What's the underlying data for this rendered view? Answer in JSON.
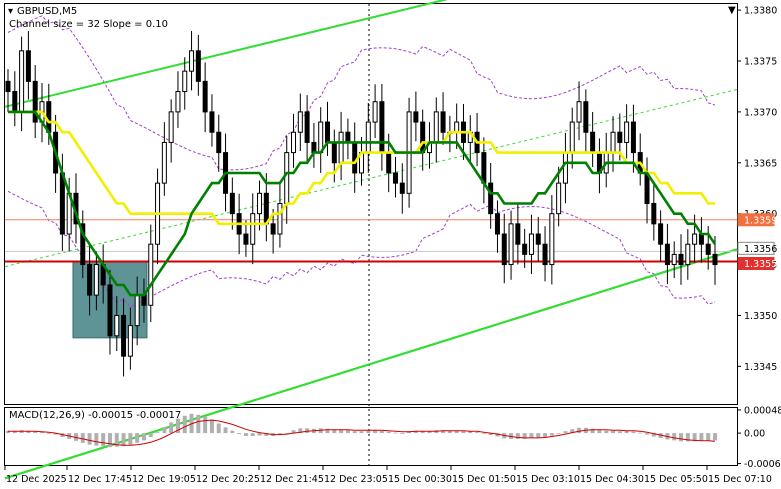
{
  "header": {
    "symbol": "GBPUSD,M5",
    "channel_info": "Channel size = 32 Slope = 0.10"
  },
  "macd_header": "MACD(12,26,9) -0.00015 -0.00017",
  "colors": {
    "background": "#ffffff",
    "candles": "#000000",
    "ma_fast": "#008000",
    "ma_slow": "#f0f000",
    "bollinger": "#a040d0",
    "channel": "#33dd33",
    "channel_mid": "#33dd33",
    "support": "#d00000",
    "level_orange": "#f08060",
    "zone": "#5f9497",
    "macd_hist": "#b0b0b0",
    "macd_signal": "#d00000",
    "price_tag_red": "#e03030",
    "price_tag_orange": "#f07040",
    "grid": "#d8d8d8"
  },
  "chart_data": {
    "type": "candlestick",
    "title": "GBPUSD,M5",
    "subtitle": "Channel size = 32 Slope = 0.10",
    "y_ticks": [
      "1.3380",
      "1.3375",
      "1.3370",
      "1.3365",
      "1.3360",
      "1.3355",
      "1.3350",
      "1.3345"
    ],
    "y_tick_values": [
      1.338,
      1.3375,
      1.337,
      1.3365,
      1.336,
      1.3355,
      1.335,
      1.3345
    ],
    "ylim": [
      1.33413,
      1.33806
    ],
    "x_ticks": [
      "12 Dec 2025",
      "12 Dec 17:45",
      "12 Dec 19:05",
      "12 Dec 20:25",
      "12 Dec 21:45",
      "12 Dec 23:05",
      "15 Dec 00:30",
      "15 Dec 01:50",
      "15 Dec 03:10",
      "15 Dec 04:30",
      "15 Dec 05:50",
      "15 Dec 07:10"
    ],
    "price_tags": [
      {
        "text": "1.3359",
        "value": 1.33594,
        "kind": "orange"
      },
      {
        "text": "1.3356",
        "value": 1.33563,
        "kind": "gray"
      },
      {
        "text": "1.3355",
        "value": 1.33553,
        "kind": "red"
      }
    ],
    "horizontal_levels": [
      {
        "value": 1.33594,
        "kind": "orange"
      },
      {
        "value": 1.33553,
        "kind": "support"
      }
    ],
    "close": [
      1.3372,
      1.337,
      1.3376,
      1.3373,
      1.3369,
      1.3371,
      1.3368,
      1.3364,
      1.3358,
      1.3362,
      1.3359,
      1.3355,
      1.3352,
      1.3355,
      1.3353,
      1.3348,
      1.335,
      1.3346,
      1.3349,
      1.3352,
      1.3351,
      1.3357,
      1.3363,
      1.3367,
      1.337,
      1.3372,
      1.3374,
      1.3376,
      1.3373,
      1.337,
      1.3368,
      1.3366,
      1.3362,
      1.336,
      1.3358,
      1.3357,
      1.336,
      1.3362,
      1.3359,
      1.3358,
      1.3361,
      1.3366,
      1.3368,
      1.337,
      1.3367,
      1.3366,
      1.3369,
      1.3367,
      1.3365,
      1.3368,
      1.3367,
      1.3364,
      1.3366,
      1.3369,
      1.3371,
      1.3366,
      1.3364,
      1.3363,
      1.3362,
      1.337,
      1.3369,
      1.3366,
      1.3367,
      1.337,
      1.3368,
      1.3368,
      1.3369,
      1.3367,
      1.3368,
      1.3366,
      1.3363,
      1.336,
      1.3358,
      1.3355,
      1.3359,
      1.3357,
      1.3356,
      1.3358,
      1.3357,
      1.3355,
      1.336,
      1.3363,
      1.3366,
      1.3369,
      1.3371,
      1.3368,
      1.3366,
      1.3364,
      1.3366,
      1.3368,
      1.3367,
      1.3369,
      1.3366,
      1.3364,
      1.3361,
      1.3359,
      1.3357,
      1.3355,
      1.3356,
      1.3355,
      1.3357,
      1.3358,
      1.3357,
      1.3356,
      1.3355
    ],
    "ma_fast": [
      1.337,
      1.337,
      1.337,
      1.337,
      1.337,
      1.3369,
      1.3368,
      1.3366,
      1.3364,
      1.3362,
      1.336,
      1.3358,
      1.3357,
      1.3356,
      1.3355,
      1.3354,
      1.3353,
      1.3353,
      1.3352,
      1.3352,
      1.3352,
      1.3353,
      1.3354,
      1.3355,
      1.3356,
      1.3357,
      1.3358,
      1.336,
      1.3361,
      1.3362,
      1.3363,
      1.3363,
      1.3364,
      1.3364,
      1.3364,
      1.3364,
      1.3364,
      1.3364,
      1.3363,
      1.3363,
      1.3363,
      1.3364,
      1.3364,
      1.3365,
      1.3365,
      1.3366,
      1.3366,
      1.3367,
      1.3367,
      1.3367,
      1.3367,
      1.3367,
      1.3367,
      1.3367,
      1.3367,
      1.3367,
      1.3367,
      1.3366,
      1.3366,
      1.3366,
      1.3366,
      1.3366,
      1.3367,
      1.3367,
      1.3367,
      1.3367,
      1.3367,
      1.3366,
      1.3365,
      1.3364,
      1.3363,
      1.3362,
      1.3362,
      1.3361,
      1.3361,
      1.3361,
      1.3361,
      1.3361,
      1.3362,
      1.3362,
      1.3363,
      1.3364,
      1.3365,
      1.3365,
      1.3365,
      1.3365,
      1.3364,
      1.3364,
      1.3365,
      1.3365,
      1.3365,
      1.3365,
      1.3365,
      1.3364,
      1.3364,
      1.3363,
      1.3362,
      1.3361,
      1.336,
      1.336,
      1.3359,
      1.3359,
      1.3358,
      1.3358,
      1.3357
    ],
    "ma_slow": [
      1.337,
      1.337,
      1.337,
      1.337,
      1.337,
      1.337,
      1.3369,
      1.3369,
      1.3368,
      1.3368,
      1.3367,
      1.3366,
      1.3365,
      1.3364,
      1.3363,
      1.3362,
      1.3361,
      1.3361,
      1.336,
      1.336,
      1.336,
      1.336,
      1.336,
      1.336,
      1.336,
      1.336,
      1.336,
      1.336,
      1.336,
      1.336,
      1.336,
      1.3359,
      1.3359,
      1.3359,
      1.3359,
      1.3359,
      1.3359,
      1.3359,
      1.3359,
      1.336,
      1.336,
      1.3361,
      1.3361,
      1.3362,
      1.3362,
      1.3363,
      1.3363,
      1.3364,
      1.3364,
      1.3365,
      1.3365,
      1.3365,
      1.3366,
      1.3366,
      1.3366,
      1.3366,
      1.3366,
      1.3366,
      1.3366,
      1.3366,
      1.3366,
      1.3367,
      1.3367,
      1.3367,
      1.3367,
      1.3368,
      1.3368,
      1.3368,
      1.3368,
      1.3367,
      1.3367,
      1.3367,
      1.3366,
      1.3366,
      1.3366,
      1.3366,
      1.3366,
      1.3366,
      1.3366,
      1.3366,
      1.3366,
      1.3366,
      1.3366,
      1.3366,
      1.3366,
      1.3366,
      1.3366,
      1.3366,
      1.3366,
      1.3366,
      1.3366,
      1.3365,
      1.3365,
      1.3365,
      1.3364,
      1.3364,
      1.3363,
      1.3363,
      1.3362,
      1.3362,
      1.3362,
      1.3362,
      1.3362,
      1.3361,
      1.3361
    ],
    "macd": {
      "label": "MACD(12,26,9)",
      "main": -0.00015,
      "signal": -0.00017,
      "y_ticks": [
        "0.00048",
        "0.00",
        "-0.00063"
      ],
      "y_tick_values": [
        0.00048,
        0.0,
        -0.00063
      ],
      "ylim": [
        -0.00066,
        0.00052
      ],
      "histogram": [
        5e-05,
        4e-05,
        6e-05,
        5e-05,
        4e-05,
        2e-05,
        0.0,
        -3e-05,
        -8e-05,
        -0.00012,
        -0.00016,
        -0.0002,
        -0.00024,
        -0.00026,
        -0.00027,
        -0.00029,
        -0.00028,
        -0.00027,
        -0.00024,
        -0.0002,
        -0.00015,
        -8e-05,
        2e-05,
        0.00012,
        0.00022,
        0.0003,
        0.00036,
        0.0004,
        0.00038,
        0.00034,
        0.00028,
        0.0002,
        0.00012,
        5e-05,
        -2e-05,
        -6e-05,
        -6e-05,
        -5e-05,
        -6e-05,
        -6e-05,
        -4e-05,
        0.0,
        6e-05,
        0.0001,
        0.0001,
        9e-05,
        0.0001,
        9e-05,
        7e-05,
        7e-05,
        6e-05,
        4e-05,
        4e-05,
        5e-05,
        7e-05,
        5e-05,
        3e-05,
        1e-05,
        0.0,
        4e-05,
        5e-05,
        4e-05,
        4e-05,
        6e-05,
        6e-05,
        5e-05,
        5e-05,
        4e-05,
        4e-05,
        2e-05,
        -1e-05,
        -4e-05,
        -7e-05,
        -0.00011,
        -0.00012,
        -0.00012,
        -0.00012,
        -0.0001,
        -9e-05,
        -9e-05,
        -5e-05,
        0.0,
        4e-05,
        8e-05,
        0.00011,
        0.00011,
        9e-05,
        6e-05,
        5e-05,
        5e-05,
        4e-05,
        5e-05,
        3e-05,
        1e-05,
        -3e-05,
        -7e-05,
        -0.0001,
        -0.00013,
        -0.00015,
        -0.00017,
        -0.00017,
        -0.00017,
        -0.00016,
        -0.00016,
        -0.00015
      ],
      "signal_line": [
        4e-05,
        4e-05,
        4e-05,
        4e-05,
        4e-05,
        3e-05,
        2e-05,
        0.0,
        -3e-05,
        -6e-05,
        -9e-05,
        -0.00012,
        -0.00015,
        -0.00018,
        -0.0002,
        -0.00022,
        -0.00024,
        -0.00025,
        -0.00025,
        -0.00024,
        -0.00022,
        -0.00019,
        -0.00014,
        -8e-05,
        -1e-05,
        6e-05,
        0.00013,
        0.00019,
        0.00024,
        0.00026,
        0.00027,
        0.00025,
        0.00022,
        0.00018,
        0.00013,
        8e-05,
        4e-05,
        1e-05,
        -1e-05,
        -3e-05,
        -3e-05,
        -2e-05,
        0.0,
        2e-05,
        4e-05,
        5e-05,
        6e-05,
        7e-05,
        7e-05,
        7e-05,
        7e-05,
        6e-05,
        6e-05,
        6e-05,
        6e-05,
        6e-05,
        5e-05,
        4e-05,
        3e-05,
        3e-05,
        4e-05,
        4e-05,
        4e-05,
        4e-05,
        5e-05,
        5e-05,
        5e-05,
        5e-05,
        4e-05,
        4e-05,
        2e-05,
        0.0,
        -2e-05,
        -5e-05,
        -7e-05,
        -9e-05,
        -0.0001,
        -0.0001,
        -0.0001,
        -9e-05,
        -7e-05,
        -5e-05,
        -2e-05,
        1e-05,
        4e-05,
        6e-05,
        7e-05,
        7e-05,
        7e-05,
        6e-05,
        6e-05,
        5e-05,
        5e-05,
        4e-05,
        2e-05,
        -1e-05,
        -4e-05,
        -7e-05,
        -0.0001,
        -0.00012,
        -0.00014,
        -0.00015,
        -0.00016,
        -0.00016,
        -0.00017
      ]
    }
  }
}
